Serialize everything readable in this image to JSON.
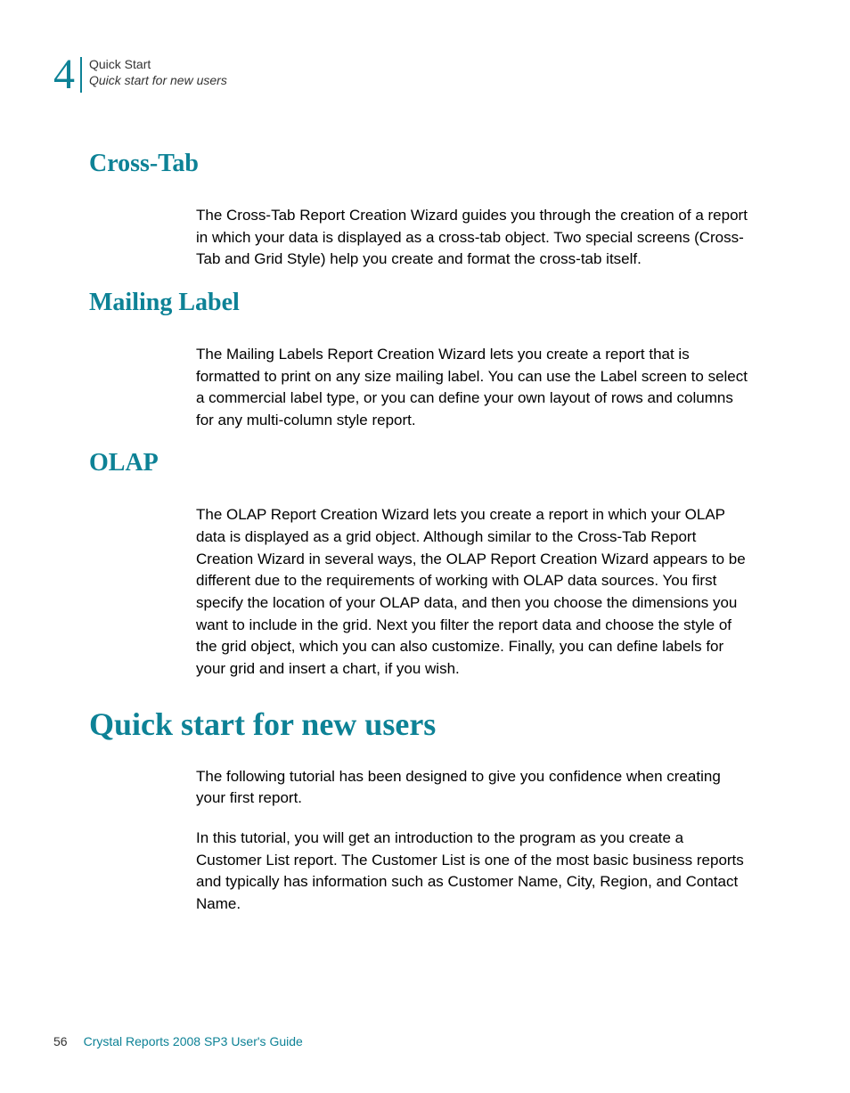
{
  "header": {
    "chapter_number": "4",
    "title": "Quick Start",
    "subtitle": "Quick start for new users"
  },
  "sections": {
    "crosstab": {
      "heading": "Cross-Tab",
      "body": "The Cross-Tab Report Creation Wizard guides you through the creation of a report in which your data is displayed as a cross-tab object. Two special screens (Cross-Tab and Grid Style) help you create and format the cross-tab itself."
    },
    "mailinglabel": {
      "heading": "Mailing Label",
      "body": "The Mailing Labels Report Creation Wizard lets you create a report that is formatted to print on any size mailing label. You can use the Label screen to select a commercial label type, or you can define your own layout of rows and columns for any multi-column style report."
    },
    "olap": {
      "heading": "OLAP",
      "body": "The OLAP Report Creation Wizard lets you create a report in which your OLAP data is displayed as a grid object. Although similar to the Cross-Tab Report Creation Wizard in several ways, the OLAP Report Creation Wizard appears to be different due to the requirements of working with OLAP data sources. You first specify the location of your OLAP data, and then you choose the dimensions you want to include in the grid. Next you filter the report data and choose the style of the grid object, which you can also customize. Finally, you can define labels for your grid and insert a chart, if you wish."
    },
    "quickstart": {
      "heading": "Quick start for new users",
      "body1": "The following tutorial has been designed to give you confidence when creating your first report.",
      "body2": "In this tutorial, you will get an introduction to the program as you create a Customer List report. The Customer List is one of the most basic business reports and typically has information such as Customer Name, City, Region, and Contact Name."
    }
  },
  "footer": {
    "page_number": "56",
    "guide_title": "Crystal Reports 2008 SP3 User's Guide"
  }
}
